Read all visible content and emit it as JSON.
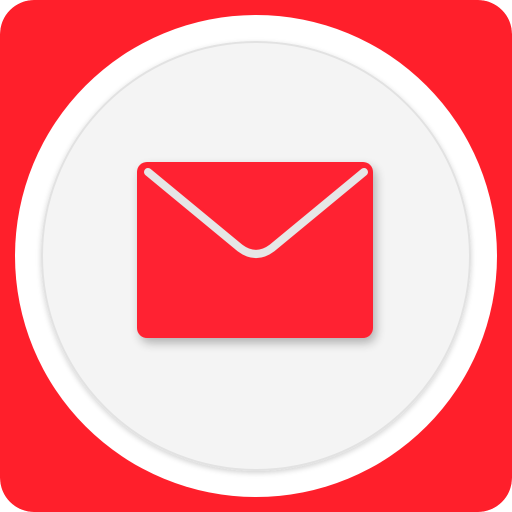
{
  "app_icon": {
    "icon": "mail-envelope-icon",
    "colors": {
      "background": "#ff1f2b",
      "outer_circle": "#ffffff",
      "inner_circle": "#f4f4f4",
      "ring_shadow": "#e2e2e2",
      "envelope": "#ff2130",
      "flap_edge": "#e6e6e6",
      "envelope_shadow": "#000000"
    }
  }
}
